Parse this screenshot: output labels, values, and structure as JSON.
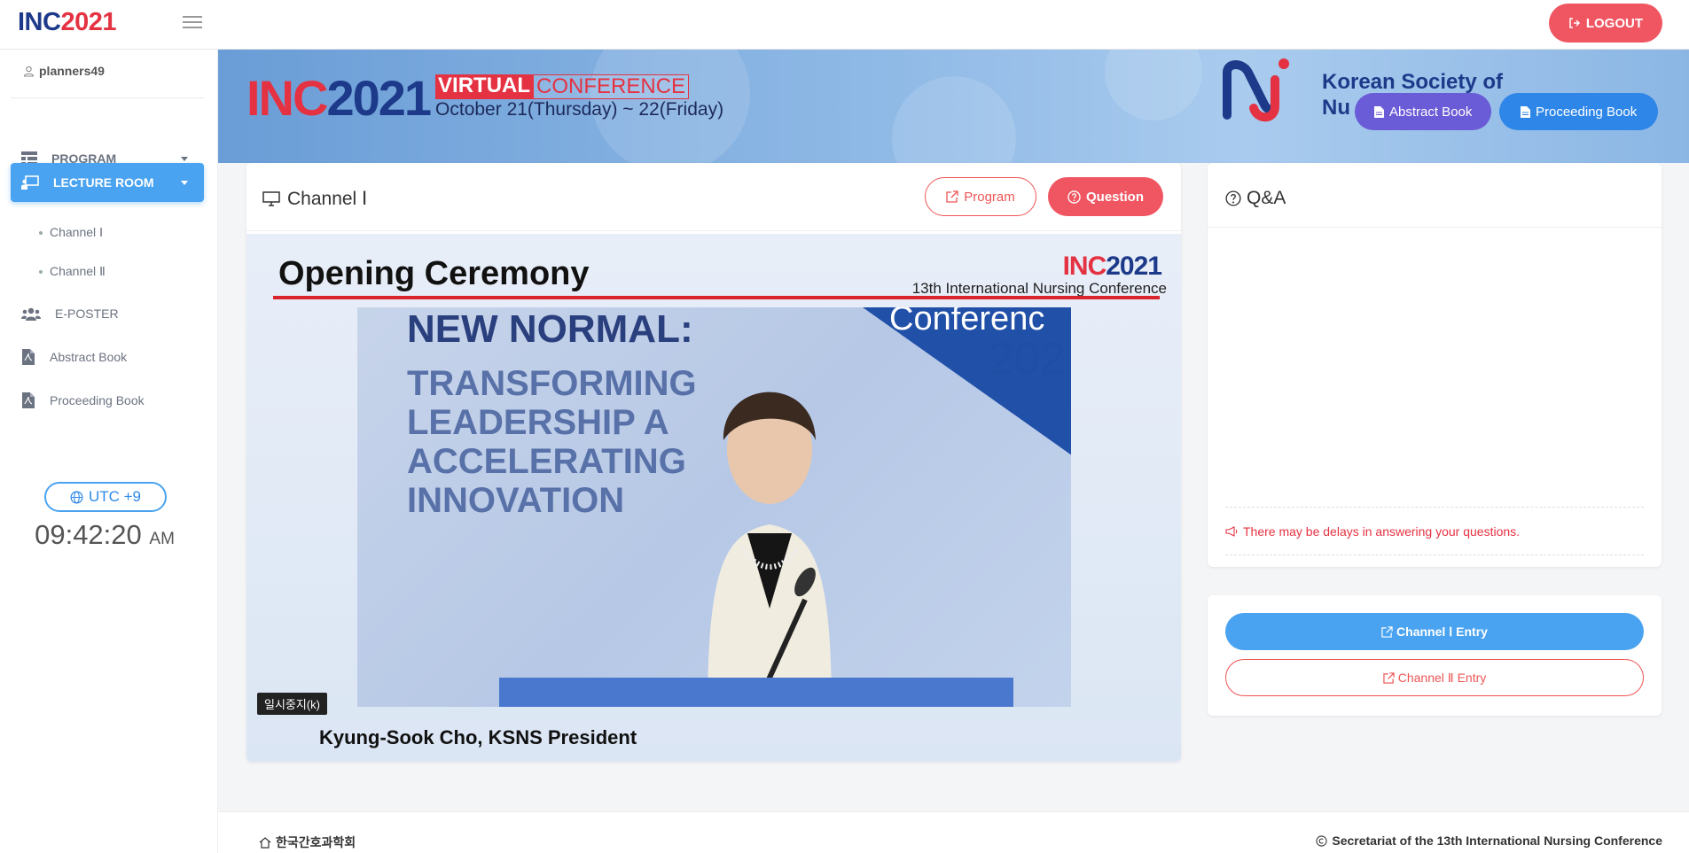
{
  "header": {
    "brand_inc": "INC",
    "brand_year": "2021",
    "logout_label": "LOGOUT"
  },
  "sidebar": {
    "username": "planners49",
    "nav": {
      "program": "PROGRAM",
      "lecture_room": "LECTURE ROOM",
      "channel_1": "Channel Ⅰ",
      "channel_2": "Channel Ⅱ",
      "eposter": "E-POSTER",
      "abstract_book": "Abstract Book",
      "proceeding_book": "Proceeding Book"
    },
    "timezone": "UTC +9",
    "clock_time": "09:42:20",
    "clock_ampm": "AM"
  },
  "banner": {
    "inc": "INC",
    "year": "2021",
    "virtual": "VIRTUAL",
    "conference": "CONFERENCE",
    "dates": "October 21(Thursday) ~ 22(Friday)",
    "society_line1": "Korean Society of",
    "society_line2": "Nu",
    "abstract_btn": "Abstract Book",
    "proceeding_btn": "Proceeding Book"
  },
  "channel": {
    "title": "Channel Ⅰ",
    "program_btn": "Program",
    "question_btn": "Question"
  },
  "video": {
    "title": "Opening Ceremony",
    "inc": "INC",
    "year": "2021",
    "conference_sub": "13th  International Nursing Conference",
    "slide_conf": "Conferenc",
    "slide_year": "202",
    "slide_heading": "NEW NORMAL:",
    "slide_line1": "TRANSFORMING",
    "slide_line2": "LEADERSHIP A",
    "slide_line3": "ACCELERATING",
    "slide_line4": "INNOVATION",
    "pause_label": "일시중지(k)",
    "caption": "Kyung-Sook Cho, KSNS President"
  },
  "qa": {
    "title": "Q&A",
    "notice": "There may be delays in answering your questions."
  },
  "entries": {
    "channel_1": "Channel Ⅰ Entry",
    "channel_2": "Channel Ⅱ Entry"
  },
  "footer": {
    "left": "한국간호과학회",
    "right": "Secretariat of the 13th International Nursing Conference"
  },
  "colors": {
    "brand_navy": "#1d3a8a",
    "brand_red": "#e53242",
    "accent_blue": "#4aa3f0",
    "button_red": "#ef5662",
    "button_purple": "#6a5bd6"
  }
}
